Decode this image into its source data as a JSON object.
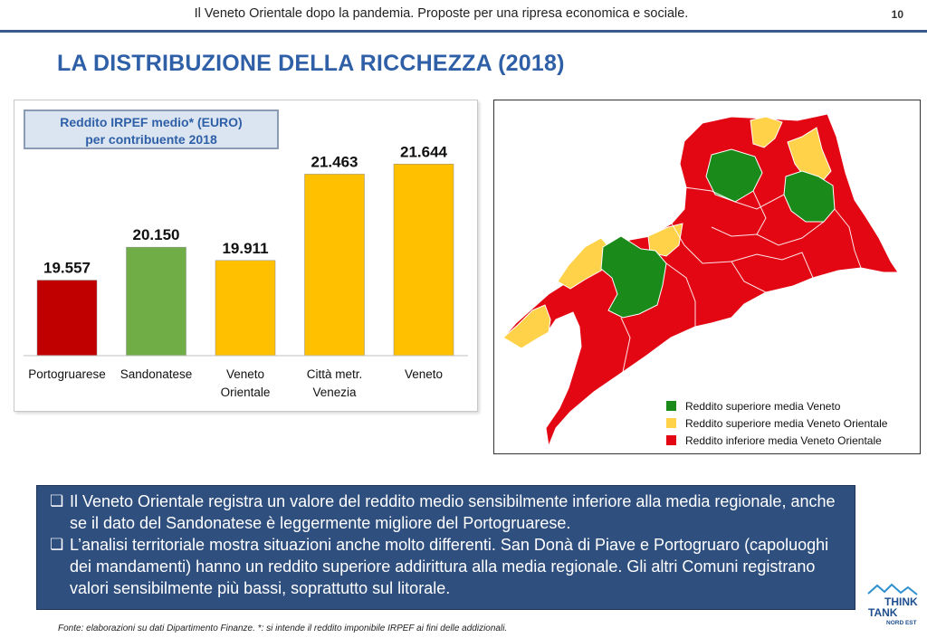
{
  "header": {
    "title": "Il Veneto Orientale dopo la pandemia. Proposte per una ripresa economica e sociale.",
    "page_number": "10"
  },
  "slide": {
    "title": "LA DISTRIBUZIONE DELLA RICCHEZZA (2018)"
  },
  "chart_box": {
    "line1": "Reddito IRPEF medio* (EURO)",
    "line2": "per contribuente 2018"
  },
  "chart_data": {
    "type": "bar",
    "categories": [
      "Portogruarese",
      "Sandonatese",
      "Veneto Orientale",
      "Città metr. Venezia",
      "Veneto"
    ],
    "category_lines": [
      [
        "Portogruarese"
      ],
      [
        "Sandonatese"
      ],
      [
        "Veneto",
        "Orientale"
      ],
      [
        "Città metr.",
        "Venezia"
      ],
      [
        "Veneto"
      ]
    ],
    "values": [
      19557,
      20150,
      19911,
      21463,
      21644
    ],
    "value_labels": [
      "19.557",
      "20.150",
      "19.911",
      "21.463",
      "21.644"
    ],
    "colors": [
      "#c00000",
      "#70ad47",
      "#ffc000",
      "#ffc000",
      "#ffc000"
    ],
    "title": "Reddito IRPEF medio* (EURO) per contribuente 2018",
    "xlabel": "",
    "ylabel": "",
    "ylim": [
      18200,
      22300
    ],
    "grid": false
  },
  "map": {
    "colors": {
      "green": "#1a8a1a",
      "yellow": "#ffd24a",
      "red": "#e30613"
    },
    "legend": [
      {
        "label": "Reddito superiore media Veneto",
        "color": "#1a8a1a"
      },
      {
        "label": "Reddito superiore media Veneto Orientale",
        "color": "#ffd24a"
      },
      {
        "label": "Reddito inferiore media Veneto Orientale",
        "color": "#e30613"
      }
    ]
  },
  "summary": {
    "bullet_icon": "checkbox-bullet",
    "bullets": [
      "Il Veneto Orientale registra un valore del reddito medio sensibilmente inferiore alla media regionale, anche se il dato del Sandonatese è leggermente migliore del Portogruarese.",
      "L’analisi territoriale mostra situazioni anche molto differenti. San Donà di Piave e Portogruaro (capoluoghi dei mandamenti) hanno un reddito superiore addirittura alla media regionale. Gli altri Comuni registrano valori sensibilmente più bassi, soprattutto sul litorale."
    ]
  },
  "footer": {
    "source": "Fonte: elaborazioni su dati Dipartimento Finanze. *: si intende il reddito imponibile IRPEF ai fini delle addizionali."
  },
  "logo": {
    "line1": "THINK",
    "line2": "TANK",
    "line3": "NORD EST"
  }
}
